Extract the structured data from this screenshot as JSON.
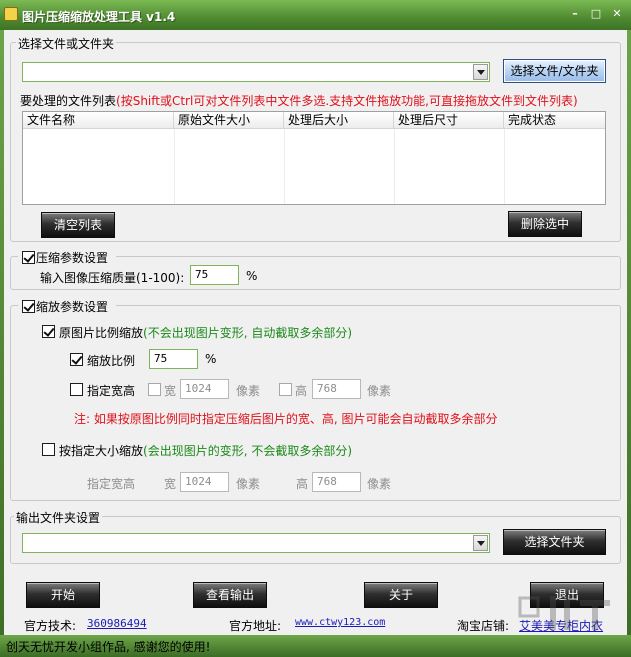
{
  "window": {
    "title": "图片压缩缩放处理工具 v1.4"
  },
  "file_section": {
    "legend": "选择文件或文件夹",
    "path_value": "",
    "select_button": "选择文件/文件夹",
    "list_label": "要处理的文件列表",
    "list_hint": "(按Shift或Ctrl可对文件列表中文件多选.支持文件拖放功能,可直接拖放文件到文件列表)",
    "columns": [
      "文件名称",
      "原始文件大小",
      "处理后大小",
      "处理后尺寸",
      "完成状态"
    ],
    "clear_button": "清空列表",
    "delete_button": "删除选中"
  },
  "compress": {
    "checked": true,
    "legend": "压缩参数设置",
    "quality_label": "输入图像压缩质量(1-100):",
    "quality_value": "75",
    "unit": "%"
  },
  "scale": {
    "checked": true,
    "legend": "缩放参数设置",
    "ratio_mode": {
      "checked": true,
      "label": "原图片比例缩放",
      "note": "(不会出现图片变形, 自动截取多余部分)"
    },
    "scale_ratio": {
      "checked": true,
      "label": "缩放比例",
      "value": "75",
      "unit": "%"
    },
    "fixed_wh": {
      "checked": false,
      "label": "指定宽高",
      "width_label": "宽",
      "width_value": "1024",
      "width_unit": "像素",
      "height_label": "高",
      "height_value": "768",
      "height_unit": "像素"
    },
    "warning": "注: 如果按原图比例同时指定压缩后图片的宽、高, 图片可能会自动截取多余部分",
    "size_mode": {
      "checked": false,
      "label": "按指定大小缩放",
      "note": "(会出现图片的变形, 不会截取多余部分)"
    },
    "size_wh": {
      "label": "指定宽高",
      "width_label": "宽",
      "width_value": "1024",
      "width_unit": "像素",
      "height_label": "高",
      "height_value": "768",
      "height_unit": "像素"
    }
  },
  "output": {
    "legend": "输出文件夹设置",
    "path_value": "",
    "select_button": "选择文件夹"
  },
  "actions": {
    "start": "开始",
    "view_output": "查看输出",
    "about": "关于",
    "exit": "退出"
  },
  "footer": {
    "tech_label": "官方技术:",
    "tech_value": "360986494",
    "site_label": "官方地址:",
    "site_value": "www.ctwy123.com",
    "shop_label": "淘宝店铺:",
    "shop_value": "艾美美专柜内衣"
  },
  "status": {
    "text": "创天无忧开发小组作品, 感谢您的使用!"
  }
}
